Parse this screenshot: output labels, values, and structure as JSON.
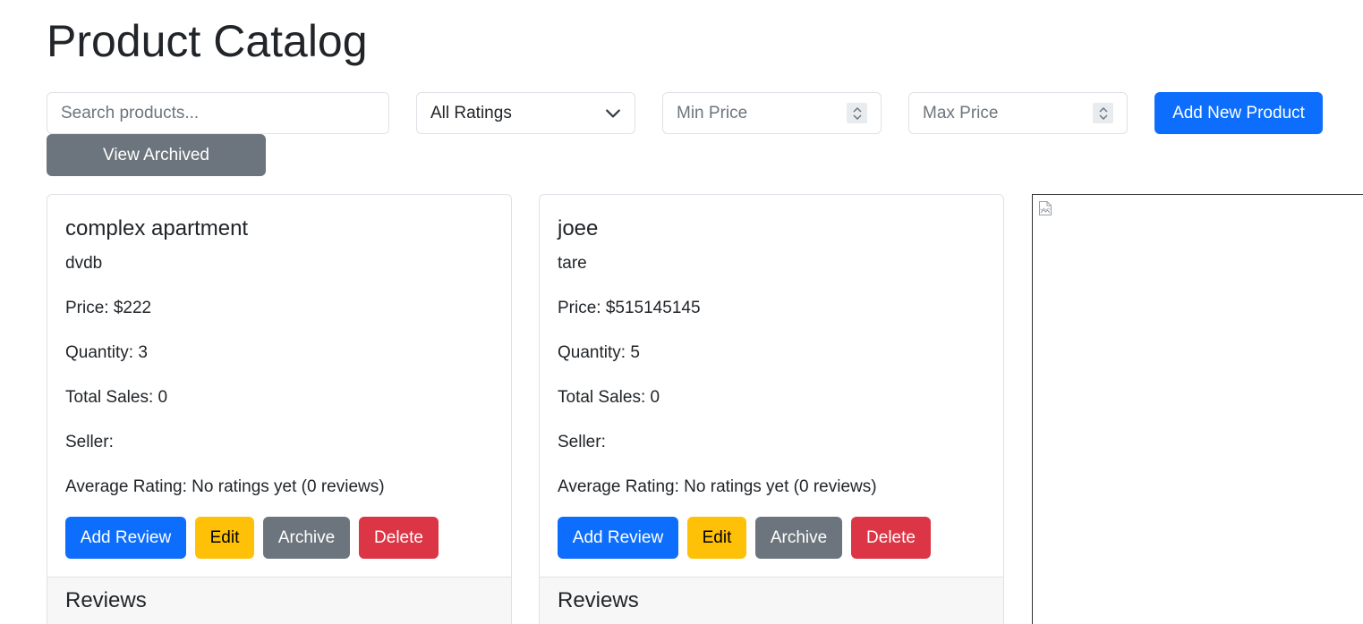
{
  "page": {
    "title": "Product Catalog"
  },
  "filters": {
    "search_placeholder": "Search products...",
    "rating_selected": "All Ratings",
    "min_price_placeholder": "Min Price",
    "max_price_placeholder": "Max Price",
    "add_new_label": "Add New Product",
    "view_archived_label": "View Archived"
  },
  "colors": {
    "primary": "#0d6efd",
    "warning": "#ffc107",
    "secondary": "#6c757d",
    "danger": "#dc3545"
  },
  "icons": {
    "select_chevron": "chevron-down-icon",
    "spinner": "number-spinner-icon",
    "broken_image": "broken-image-icon"
  },
  "products": [
    {
      "name": "complex apartment",
      "description": "dvdb",
      "price": "Price: $222",
      "quantity": "Quantity: 3",
      "total_sales": "Total Sales: 0",
      "seller": "Seller:",
      "average_rating": "Average Rating: No ratings yet (0 reviews)",
      "actions": {
        "review": "Add Review",
        "edit": "Edit",
        "archive": "Archive",
        "delete": "Delete"
      },
      "reviews_heading": "Reviews"
    },
    {
      "name": "joee",
      "description": "tare",
      "price": "Price: $515145145",
      "quantity": "Quantity: 5",
      "total_sales": "Total Sales: 0",
      "seller": "Seller:",
      "average_rating": "Average Rating: No ratings yet (0 reviews)",
      "actions": {
        "review": "Add Review",
        "edit": "Edit",
        "archive": "Archive",
        "delete": "Delete"
      },
      "reviews_heading": "Reviews"
    }
  ]
}
